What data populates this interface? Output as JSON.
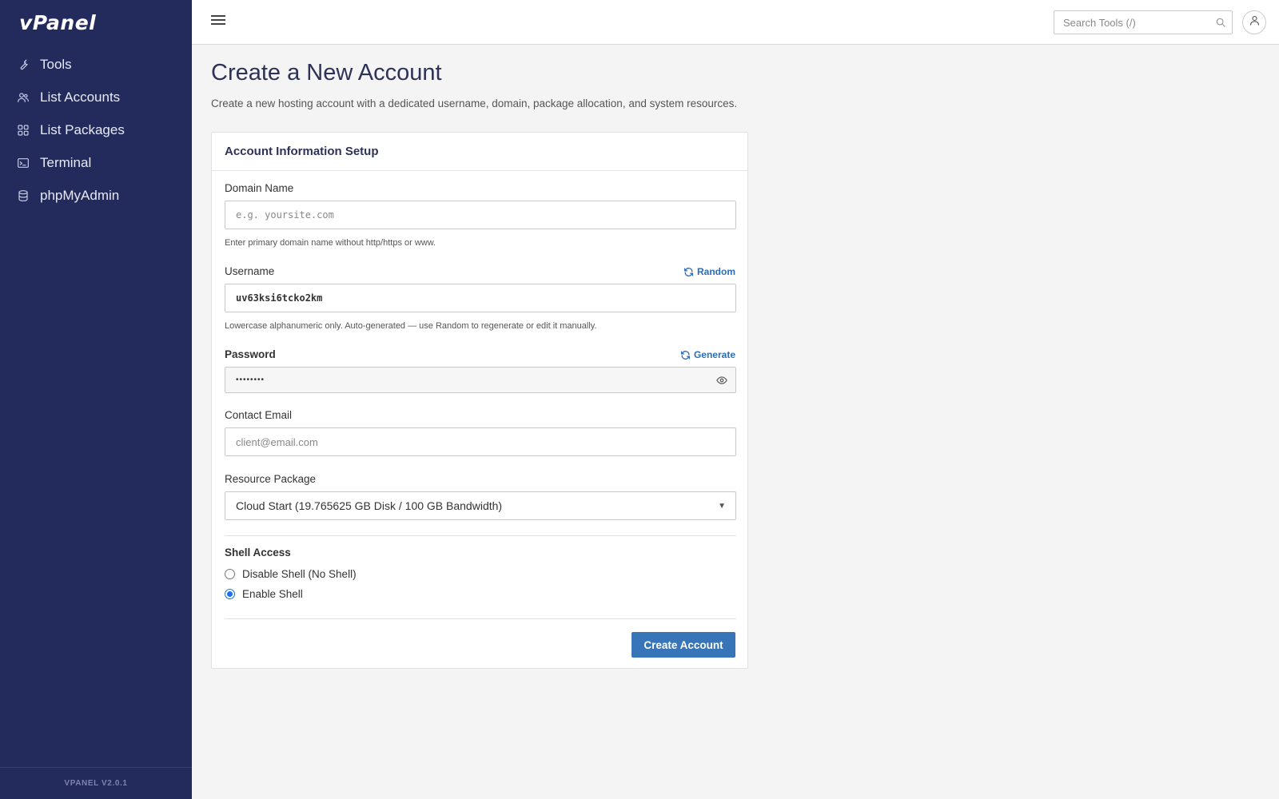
{
  "app": {
    "logo": "vPanel",
    "version": "VPANEL V2.0.1"
  },
  "sidebar": {
    "items": [
      {
        "label": "Tools",
        "icon": "wrench-icon"
      },
      {
        "label": "List Accounts",
        "icon": "users-icon"
      },
      {
        "label": "List Packages",
        "icon": "grid-icon"
      },
      {
        "label": "Terminal",
        "icon": "terminal-icon"
      },
      {
        "label": "phpMyAdmin",
        "icon": "database-icon"
      }
    ]
  },
  "topbar": {
    "search_placeholder": "Search Tools (/)"
  },
  "page": {
    "title": "Create a New Account",
    "description": "Create a new hosting account with a dedicated username, domain, package allocation, and system resources."
  },
  "form": {
    "card_title": "Account Information Setup",
    "domain": {
      "label": "Domain Name",
      "placeholder": "e.g. yoursite.com",
      "help": "Enter primary domain name without http/https or www."
    },
    "username": {
      "label": "Username",
      "action": "Random",
      "value": "uv63ksi6tcko2km",
      "help": "Lowercase alphanumeric only. Auto-generated — use Random to regenerate or edit it manually."
    },
    "password": {
      "label": "Password",
      "action": "Generate",
      "value": "••••••••"
    },
    "email": {
      "label": "Contact Email",
      "placeholder": "client@email.com"
    },
    "package": {
      "label": "Resource Package",
      "selected": "Cloud Start (19.765625 GB Disk / 100 GB Bandwidth)"
    },
    "shell": {
      "label": "Shell Access",
      "options": [
        {
          "label": "Disable Shell (No Shell)",
          "checked": false
        },
        {
          "label": "Enable Shell",
          "checked": true
        }
      ]
    },
    "submit_label": "Create Account"
  },
  "colors": {
    "sidebar": "#232a5c",
    "accent": "#3774b8",
    "link": "#2c6db5"
  }
}
